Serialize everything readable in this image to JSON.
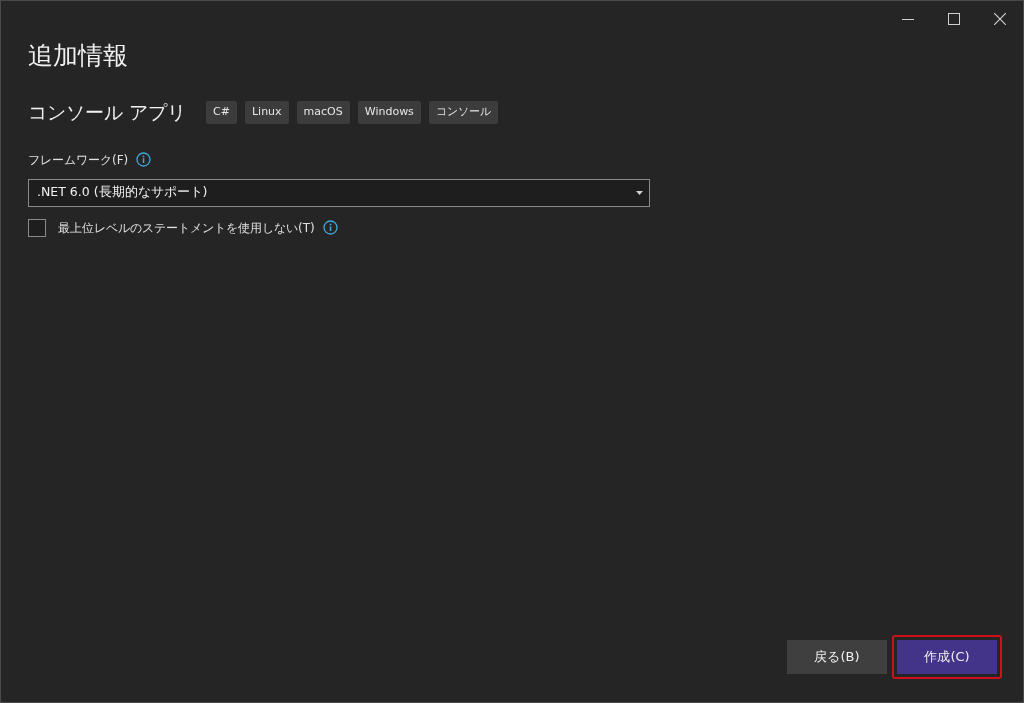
{
  "title": "追加情報",
  "project": {
    "name": "コンソール アプリ",
    "tags": [
      "C#",
      "Linux",
      "macOS",
      "Windows",
      "コンソール"
    ]
  },
  "framework": {
    "label": "フレームワーク(F)",
    "value": ".NET 6.0 (長期的なサポート)"
  },
  "option": {
    "label": "最上位レベルのステートメントを使用しない(T)",
    "checked": false
  },
  "buttons": [
    {
      "label": "戻る(B)",
      "kind": "secondary",
      "highlighted": false
    },
    {
      "label": "作成(C)",
      "kind": "primary",
      "highlighted": true
    }
  ]
}
